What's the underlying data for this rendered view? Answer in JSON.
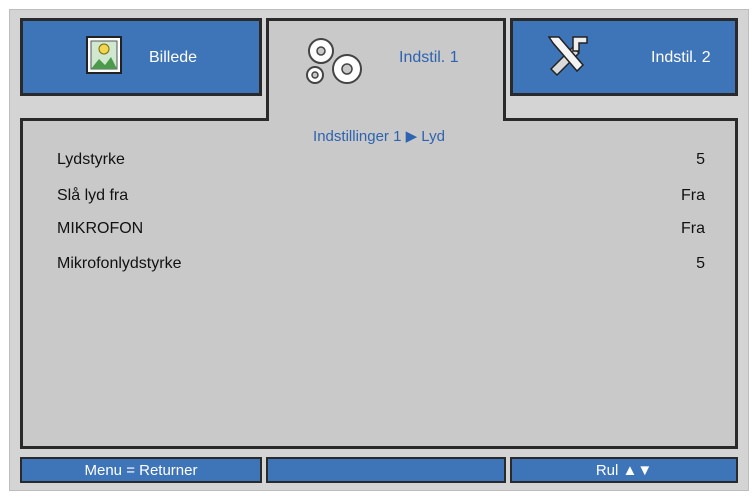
{
  "tabs": [
    {
      "label": "Billede",
      "icon": "picture-icon"
    },
    {
      "label": "Indstil. 1",
      "icon": "gears-icon",
      "active": true
    },
    {
      "label": "Indstil. 2",
      "icon": "tools-icon"
    }
  ],
  "breadcrumb": "Indstillinger 1 ▶ Lyd",
  "settings": [
    {
      "label": "Lydstyrke",
      "value": "5"
    },
    {
      "label": "Slå lyd fra",
      "value": "Fra"
    },
    {
      "label": "MIKROFON",
      "value": "Fra"
    },
    {
      "label": "Mikrofonlydstyrke",
      "value": "5"
    }
  ],
  "footer": {
    "left": "Menu = Returner",
    "middle": "",
    "right": "Rul ▲▼"
  },
  "colors": {
    "tab_blue": "#3e74b8",
    "active_text": "#2d63b0",
    "panel_gray": "#c9c9c9"
  }
}
